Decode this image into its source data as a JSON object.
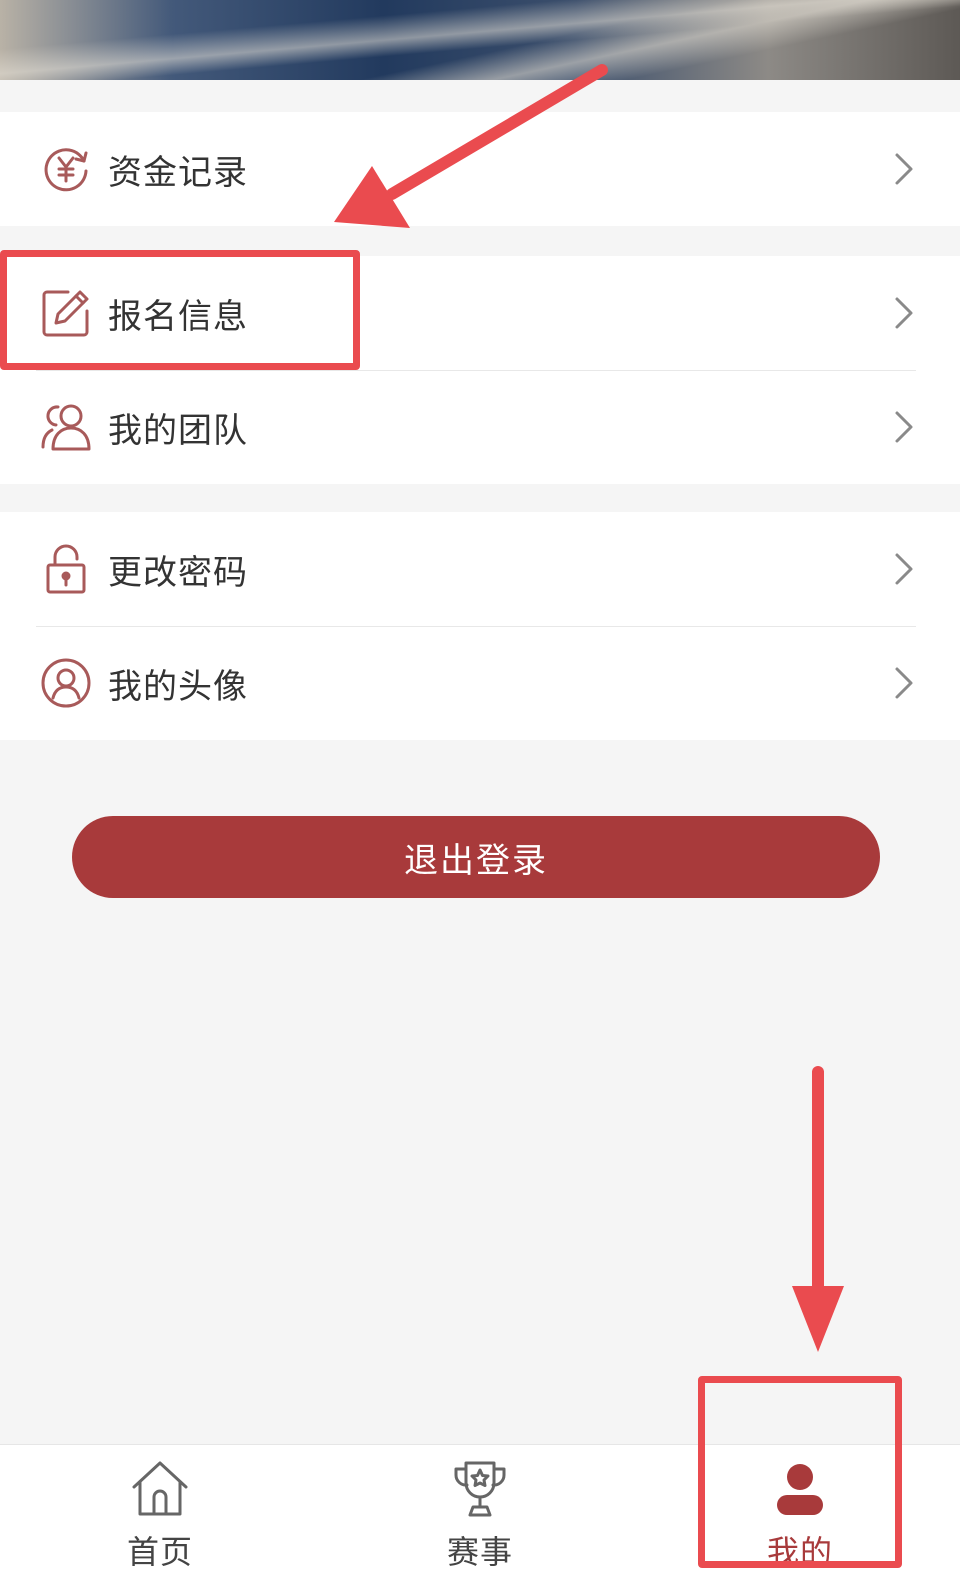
{
  "menu_groups": [
    {
      "items": [
        {
          "label": "资金记录",
          "icon": "yuan-refresh-icon"
        }
      ]
    },
    {
      "items": [
        {
          "label": "报名信息",
          "icon": "edit-icon"
        },
        {
          "label": "我的团队",
          "icon": "team-icon"
        }
      ]
    },
    {
      "items": [
        {
          "label": "更改密码",
          "icon": "lock-icon"
        },
        {
          "label": "我的头像",
          "icon": "avatar-icon"
        }
      ]
    }
  ],
  "logout_label": "退出登录",
  "tabbar": {
    "tabs": [
      {
        "label": "首页",
        "icon": "home-icon",
        "active": false
      },
      {
        "label": "赛事",
        "icon": "trophy-icon",
        "active": false
      },
      {
        "label": "我的",
        "icon": "user-icon",
        "active": true
      }
    ]
  },
  "colors": {
    "accent": "#a83a3b",
    "annotation": "#ea4b4f",
    "icon_stroke": "#a85a5a"
  }
}
